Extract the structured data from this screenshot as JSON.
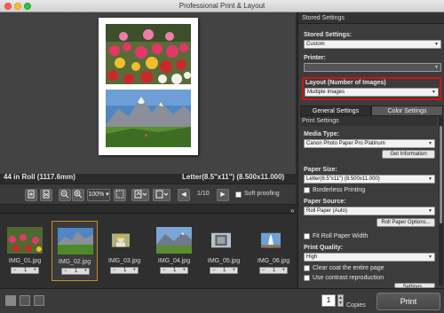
{
  "window": {
    "title": "Professional Print & Layout"
  },
  "preview": {
    "roll_label": "44 in Roll (1117.6mm)",
    "size_label": "Letter(8.5\"x11\") (8.500x11.000)"
  },
  "toolbar": {
    "zoom_value": "100%",
    "page_indicator": "1/10",
    "soft_proofing_label": "Soft proofing"
  },
  "thumbnails": [
    {
      "name": "IMG_01.jpg",
      "count": "1"
    },
    {
      "name": "IMG_02.jpg",
      "count": "1"
    },
    {
      "name": "IMG_03.jpg",
      "count": "1"
    },
    {
      "name": "IMG_04.jpg",
      "count": "1"
    },
    {
      "name": "IMG_05.jpg",
      "count": "1"
    },
    {
      "name": "IMG_06.jpg",
      "count": "1"
    }
  ],
  "bottom": {
    "copies_value": "1",
    "copies_label": "Copies",
    "print_label": "Print"
  },
  "panel": {
    "stored_settings_header": "Stored Settings",
    "stored_settings_label": "Stored Settings:",
    "stored_settings_value": "Custom",
    "printer_label": "Printer:",
    "printer_value": "",
    "layout_label": "Layout (Number of Images)",
    "layout_value": "Multiple Images",
    "tab_general": "General Settings",
    "tab_color": "Color Settings",
    "print_settings_header": "Print Settings",
    "media_type_label": "Media Type:",
    "media_type_value": "Canon Photo Paper Pro Platinum",
    "get_information_button": "Get Information",
    "paper_size_label": "Paper Size:",
    "paper_size_value": "Letter(8.5\"x11\") (8.500x11.000)",
    "borderless_label": "Borderless Printing",
    "paper_source_label": "Paper Source:",
    "paper_source_value": "Roll Paper (Auto)",
    "roll_paper_options_button": "Roll Paper Options...",
    "fit_roll_label": "Fit Roll Paper Width",
    "print_quality_label": "Print Quality:",
    "print_quality_value": "High",
    "clear_coat_label": "Clear coat the entire page",
    "contrast_label": "Use contrast reproduction",
    "settings_button": "Settings..."
  },
  "colors": {
    "highlight": "#d41212",
    "selected_thumb": "#d08a2a",
    "panel_bg": "#3c3c3c",
    "preview_bg": "#434343"
  }
}
